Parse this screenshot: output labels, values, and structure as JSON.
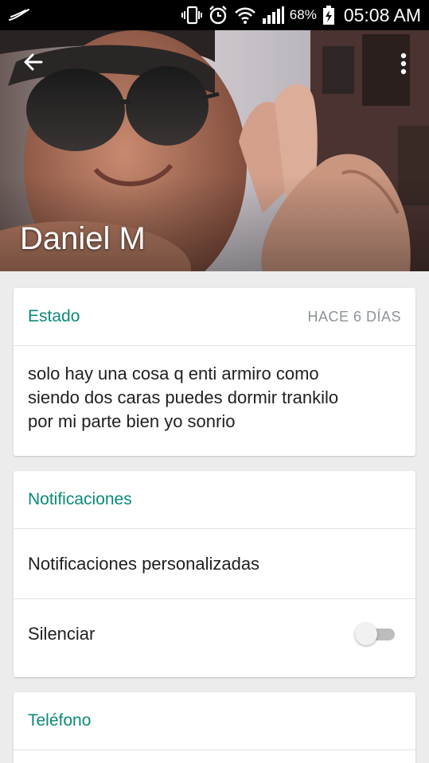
{
  "status_bar": {
    "battery_percent": "68%",
    "time": "05:08 AM",
    "icons": [
      "app-notification-icon",
      "vibrate-icon",
      "alarm-icon",
      "wifi-icon",
      "signal-icon",
      "battery-charging-icon"
    ]
  },
  "header": {
    "contact_name": "Daniel M",
    "back_icon": "arrow-back-icon",
    "menu_icon": "more-vert-icon"
  },
  "status_card": {
    "title": "Estado",
    "time_ago": "HACE 6 DÍAS",
    "lines": [
      "solo hay una cosa q enti armiro como",
      "siendo dos caras puedes dormir trankilo",
      "por mi parte bien yo sonrio"
    ]
  },
  "notifications_card": {
    "title": "Notificaciones",
    "custom_label": "Notificaciones personalizadas",
    "mute_label": "Silenciar",
    "mute_enabled": false
  },
  "phone_card": {
    "title": "Teléfono"
  },
  "colors": {
    "accent": "#0a8a78",
    "meta": "#8b9497",
    "background": "#ececec"
  }
}
